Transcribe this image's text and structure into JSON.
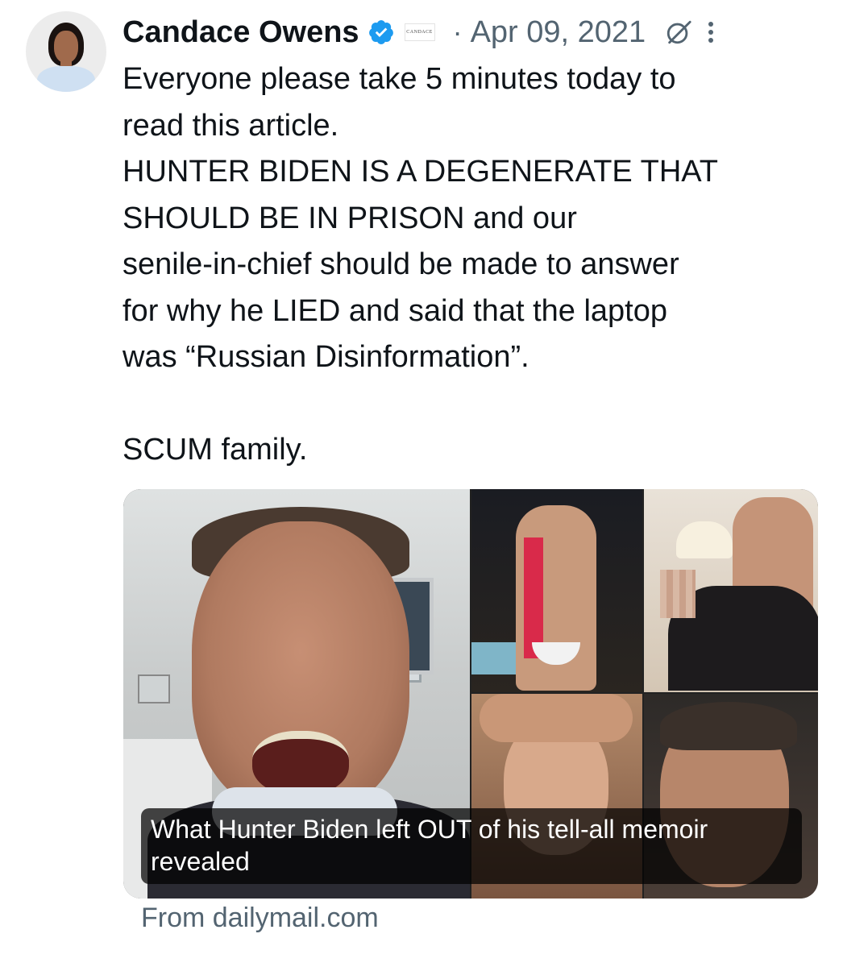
{
  "author": {
    "name": "Candace Owens",
    "affiliate_badge": "CANDACE"
  },
  "meta": {
    "separator": "·",
    "date": "Apr 09, 2021"
  },
  "post": {
    "text": "Everyone please take 5 minutes today to\nread this article.\nHUNTER BIDEN IS A DEGENERATE THAT\nSHOULD BE IN PRISON and our\nsenile-in-chief should be made to answer\nfor why he LIED and said that the laptop\nwas “Russian Disinformation”.\n\nSCUM family."
  },
  "link_card": {
    "title": "What Hunter Biden left OUT of his tell-all memoir revealed",
    "source": "From dailymail.com"
  },
  "colors": {
    "verified": "#1d9bf0",
    "secondary_text": "#536471",
    "primary_text": "#0f1419"
  },
  "icons": {
    "verified": "verified-badge-icon",
    "grok": "grok-icon",
    "more": "more-vertical-icon"
  }
}
